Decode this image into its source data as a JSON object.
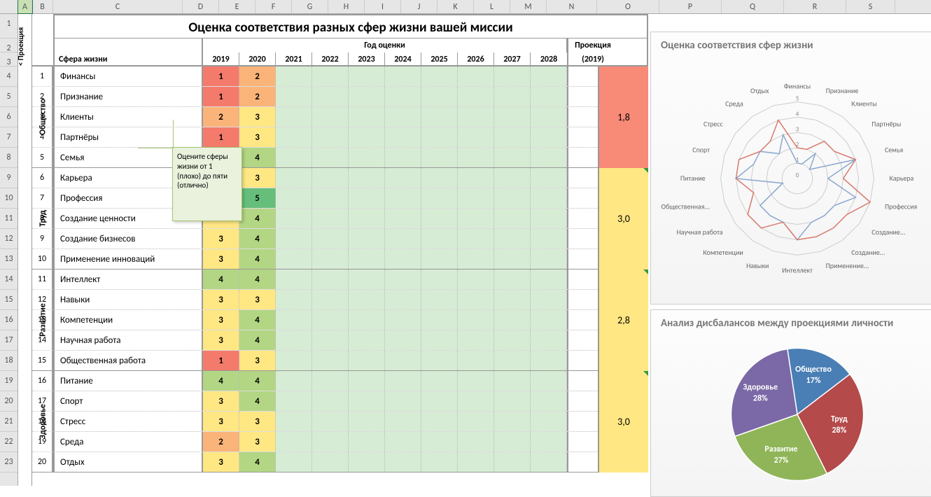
{
  "title": "Оценка соответствия разных сфер жизни вашей миссии",
  "year_header": "Год оценки",
  "proj_header": "Проекция",
  "proj_year": "(2019)",
  "sphere_header": "Сфера жизни",
  "proj_col_label": "< Проекция",
  "years": [
    "2019",
    "2020",
    "2021",
    "2022",
    "2023",
    "2024",
    "2025",
    "2026",
    "2027",
    "2028"
  ],
  "tooltip": "Оцените сферы жизни от 1 (плохо) до пяти (отлично)",
  "groups": [
    {
      "name": "Общество",
      "rows": 5,
      "proj": "1,8",
      "projClass": "p1"
    },
    {
      "name": "Труд",
      "rows": 5,
      "proj": "3,0",
      "projClass": "p2"
    },
    {
      "name": "Развитие",
      "rows": 5,
      "proj": "2,8",
      "projClass": "p2"
    },
    {
      "name": "Здоровье",
      "rows": 5,
      "proj": "3,0",
      "projClass": "p2"
    }
  ],
  "spheres": [
    {
      "n": 1,
      "name": "Финансы",
      "v": [
        1,
        2
      ]
    },
    {
      "n": 2,
      "name": "Признание",
      "v": [
        1,
        2
      ]
    },
    {
      "n": 3,
      "name": "Клиенты",
      "v": [
        2,
        3
      ]
    },
    {
      "n": 4,
      "name": "Партнёры",
      "v": [
        1,
        3
      ]
    },
    {
      "n": 5,
      "name": "Семья",
      "v": [
        4,
        4
      ]
    },
    {
      "n": 6,
      "name": "Карьера",
      "v": [
        2,
        3
      ]
    },
    {
      "n": 7,
      "name": "Профессия",
      "v": [
        4,
        5
      ]
    },
    {
      "n": 8,
      "name": "Создание ценности",
      "v": [
        3,
        4
      ]
    },
    {
      "n": 9,
      "name": "Создание бизнесов",
      "v": [
        3,
        4
      ]
    },
    {
      "n": 10,
      "name": "Применение инноваций",
      "v": [
        3,
        4
      ]
    },
    {
      "n": 11,
      "name": "Интеллект",
      "v": [
        4,
        4
      ]
    },
    {
      "n": 12,
      "name": "Навыки",
      "v": [
        3,
        3
      ]
    },
    {
      "n": 13,
      "name": "Компетенции",
      "v": [
        3,
        4
      ]
    },
    {
      "n": 14,
      "name": "Научная работа",
      "v": [
        3,
        4
      ]
    },
    {
      "n": 15,
      "name": "Общественная работа",
      "v": [
        1,
        3
      ]
    },
    {
      "n": 16,
      "name": "Питание",
      "v": [
        4,
        4
      ]
    },
    {
      "n": 17,
      "name": "Спорт",
      "v": [
        3,
        4
      ]
    },
    {
      "n": 18,
      "name": "Стресс",
      "v": [
        3,
        3
      ]
    },
    {
      "n": 19,
      "name": "Среда",
      "v": [
        2,
        3
      ]
    },
    {
      "n": 20,
      "name": "Отдых",
      "v": [
        3,
        4
      ]
    }
  ],
  "col_letters": [
    "A",
    "B",
    "C",
    "D",
    "E",
    "F",
    "G",
    "H",
    "I",
    "J",
    "K",
    "L",
    "M",
    "N",
    "O",
    "P",
    "Q",
    "R",
    "S"
  ],
  "radar_title": "Оценка соответствия сфер жизни",
  "pie_title": "Анализ дисбалансов между проекциями личности",
  "chart_data": [
    {
      "type": "radar",
      "title": "Оценка соответствия сфер жизни",
      "categories": [
        "Финансы",
        "Признание",
        "Клиенты",
        "Партнёры",
        "Семья",
        "Карьера",
        "Профессия",
        "Создание...",
        "Создание...",
        "Применение...",
        "Интеллект",
        "Навыки",
        "Компетенции",
        "Научная работа",
        "Общественная...",
        "Питание",
        "Спорт",
        "Стресс",
        "Среда",
        "Отдых"
      ],
      "series": [
        {
          "name": "2019",
          "values": [
            1,
            1,
            2,
            1,
            4,
            2,
            4,
            3,
            3,
            3,
            4,
            3,
            3,
            3,
            1,
            4,
            3,
            3,
            2,
            3
          ],
          "color": "#8aa7cf"
        },
        {
          "name": "2020",
          "values": [
            2,
            2,
            3,
            3,
            4,
            3,
            5,
            4,
            4,
            4,
            4,
            3,
            4,
            4,
            3,
            4,
            4,
            3,
            3,
            4
          ],
          "color": "#d9796d"
        }
      ],
      "ylim": [
        0,
        5
      ],
      "ticks": [
        0,
        1,
        2,
        3,
        4,
        5
      ]
    },
    {
      "type": "pie",
      "title": "Анализ дисбалансов между проекциями личности",
      "data": [
        {
          "label": "Общество",
          "value": 17,
          "color": "#4a7fb5"
        },
        {
          "label": "Труд",
          "value": 28,
          "color": "#b44a4a"
        },
        {
          "label": "Развитие",
          "value": 27,
          "color": "#8fb558"
        },
        {
          "label": "Здоровье",
          "value": 28,
          "color": "#7b68a6"
        }
      ]
    }
  ]
}
